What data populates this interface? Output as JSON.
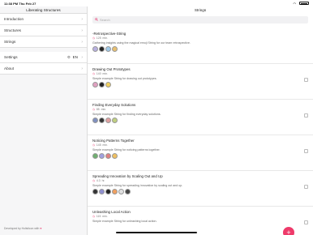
{
  "status": {
    "time": "11:38 PM",
    "date": "Thu Feb 27",
    "wifi": "WiFi",
    "battery": ""
  },
  "sidebar": {
    "title": "Liberating Structures",
    "items": [
      {
        "label": "Introduction"
      },
      {
        "label": "Structures"
      },
      {
        "label": "Strings"
      }
    ],
    "settings_label": "Settings",
    "language": "EN",
    "about_label": "About",
    "footer_text": "Developed by Holisticon with",
    "footer_heart": "♥"
  },
  "main": {
    "title": "Strings",
    "search_placeholder": "Search",
    "fab_label": "+"
  },
  "cards": [
    {
      "title": "-Retrospective-String",
      "time": "125",
      "unit": "min.",
      "desc": "Gathering insights using the magical emoji String for our team retrospective.",
      "icons": [
        "#b8b0e0",
        "#222",
        "#9ec9e8",
        "#e8c070"
      ]
    },
    {
      "title": "Drawing Out Prototypes",
      "time": "140",
      "unit": "min.",
      "desc": "Simple example String for drawing out prototypes.",
      "icons": [
        "#e0a0c0",
        "#222",
        "#f0d060"
      ]
    },
    {
      "title": "Finding Everyday Solutions",
      "time": "85",
      "unit": "min.",
      "desc": "Simple example String for finding everyday solutions.",
      "icons": [
        "#8090c0",
        "#333",
        "#e0a0a0",
        "#c0d080"
      ]
    },
    {
      "title": "Noticing Patterns Together",
      "time": "145",
      "unit": "min.",
      "desc": "Simple example String for noticing patterns together.",
      "icons": [
        "#70b070",
        "#a0a0e0",
        "#e08080",
        "#f0c060"
      ]
    },
    {
      "title": "Spreading Innovation by Scaling Out and Up",
      "time": "4.3",
      "unit": "hr.",
      "desc": "Simple example String for spreading innovation by scaling out and up.",
      "icons": [
        "#333",
        "#9090d0",
        "#222",
        "#f0a060",
        "#e0e0e0",
        "#444"
      ]
    },
    {
      "title": "Unleashing Local Action",
      "time": "115",
      "unit": "min.",
      "desc": "Simple example String for unleashing local action.",
      "icons": []
    }
  ]
}
